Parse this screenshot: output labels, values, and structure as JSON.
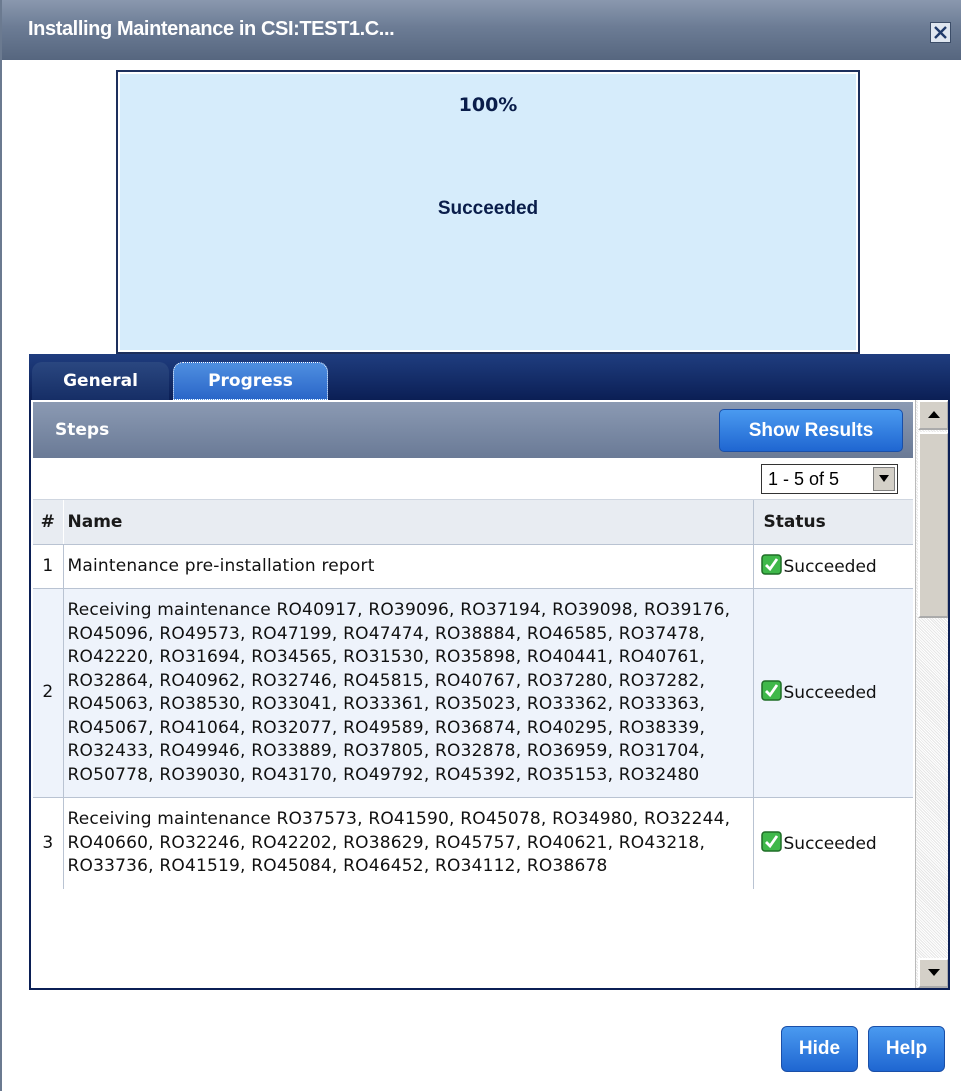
{
  "window": {
    "title": "Installing Maintenance in CSI:TEST1.C...",
    "close_icon": "close-icon"
  },
  "progress": {
    "percent_text": "100%",
    "percent_value": 100,
    "status": "Succeeded"
  },
  "tabs": [
    {
      "label": "General",
      "active": false
    },
    {
      "label": "Progress",
      "active": true
    }
  ],
  "steps": {
    "title": "Steps",
    "show_results_label": "Show Results",
    "pager_value": "1 - 5 of 5",
    "columns": {
      "num": "#",
      "name": "Name",
      "status": "Status"
    },
    "rows": [
      {
        "num": "1",
        "name": "Maintenance pre-installation report",
        "status": "Succeeded",
        "icon": "check-icon"
      },
      {
        "num": "2",
        "name": "Receiving maintenance RO40917, RO39096, RO37194, RO39098, RO39176, RO45096, RO49573, RO47199, RO47474, RO38884, RO46585, RO37478, RO42220, RO31694, RO34565, RO31530, RO35898, RO40441, RO40761, RO32864, RO40962, RO32746, RO45815, RO40767, RO37280, RO37282, RO45063, RO38530, RO33041, RO33361, RO35023, RO33362, RO33363, RO45067, RO41064, RO32077, RO49589, RO36874, RO40295, RO38339, RO32433, RO49946, RO33889, RO37805, RO32878, RO36959, RO31704, RO50778, RO39030, RO43170, RO49792, RO45392, RO35153, RO32480",
        "status": "Succeeded",
        "icon": "check-icon"
      },
      {
        "num": "3",
        "name": "Receiving maintenance RO37573, RO41590, RO45078, RO34980, RO32244, RO40660, RO32246, RO42202, RO38629, RO45757, RO40621, RO43218, RO33736, RO41519, RO45084, RO46452, RO34112, RO38678",
        "status": "Succeeded",
        "icon": "check-icon"
      }
    ]
  },
  "footer": {
    "hide_label": "Hide",
    "help_label": "Help"
  }
}
